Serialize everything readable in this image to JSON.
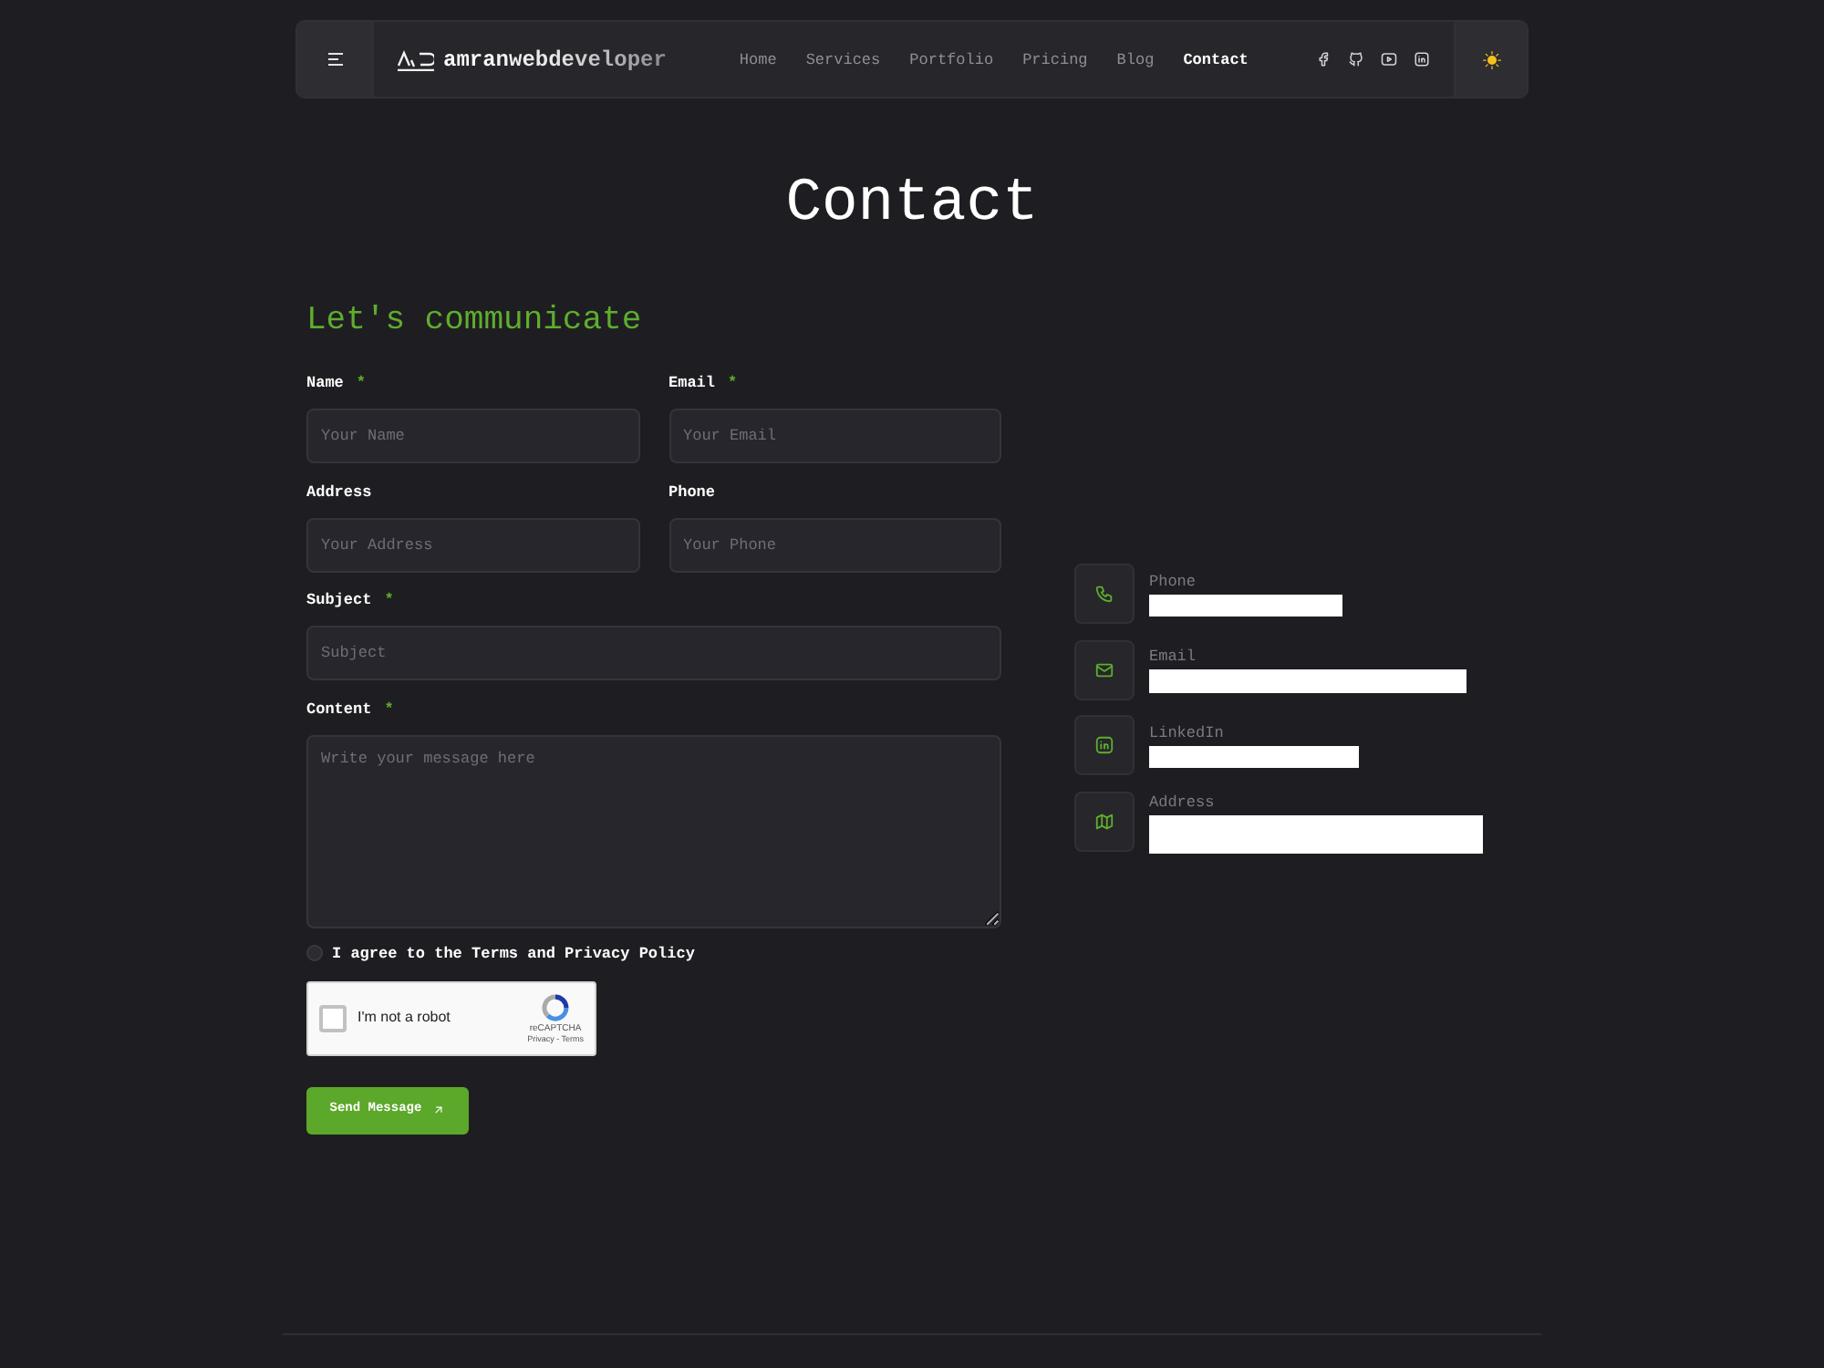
{
  "header": {
    "brand": "amranwebdeveloper",
    "nav": [
      {
        "label": "Home",
        "selected": false
      },
      {
        "label": "Services",
        "selected": false
      },
      {
        "label": "Portfolio",
        "selected": false
      },
      {
        "label": "Pricing",
        "selected": false
      },
      {
        "label": "Blog",
        "selected": false
      },
      {
        "label": "Contact",
        "selected": true
      }
    ]
  },
  "page_title": "Contact",
  "form": {
    "heading": "Let's communicate",
    "rows": [
      [
        {
          "kind": "input",
          "label": "Name",
          "required_mark": "*",
          "placeholder": "Your Name"
        },
        {
          "kind": "input",
          "label": "Email",
          "required_mark": "*",
          "placeholder": "Your Email"
        }
      ],
      [
        {
          "kind": "input",
          "label": "Address",
          "placeholder": "Your Address"
        },
        {
          "kind": "input",
          "label": "Phone",
          "placeholder": "Your Phone"
        }
      ],
      [
        {
          "kind": "input",
          "label": "Subject",
          "required_mark": "*",
          "placeholder": "Subject"
        }
      ],
      [
        {
          "kind": "textarea",
          "label": "Content",
          "required_mark": "*",
          "placeholder": "Write your message here"
        }
      ]
    ],
    "agree": {
      "text": "I agree to the Terms and Privacy Policy",
      "checked": false
    },
    "captcha": {
      "label": "I'm not a robot",
      "checked": false,
      "brand": "reCAPTCHA",
      "links": "Privacy - Terms"
    },
    "submit": "Send Message"
  },
  "contact_info": [
    {
      "kind": "phone",
      "label": "Phone",
      "redacted": true
    },
    {
      "kind": "email",
      "label": "Email",
      "redacted": true
    },
    {
      "kind": "linkedin",
      "label": "LinkedIn",
      "redacted": true
    },
    {
      "kind": "address",
      "label": "Address",
      "redacted": true
    }
  ]
}
